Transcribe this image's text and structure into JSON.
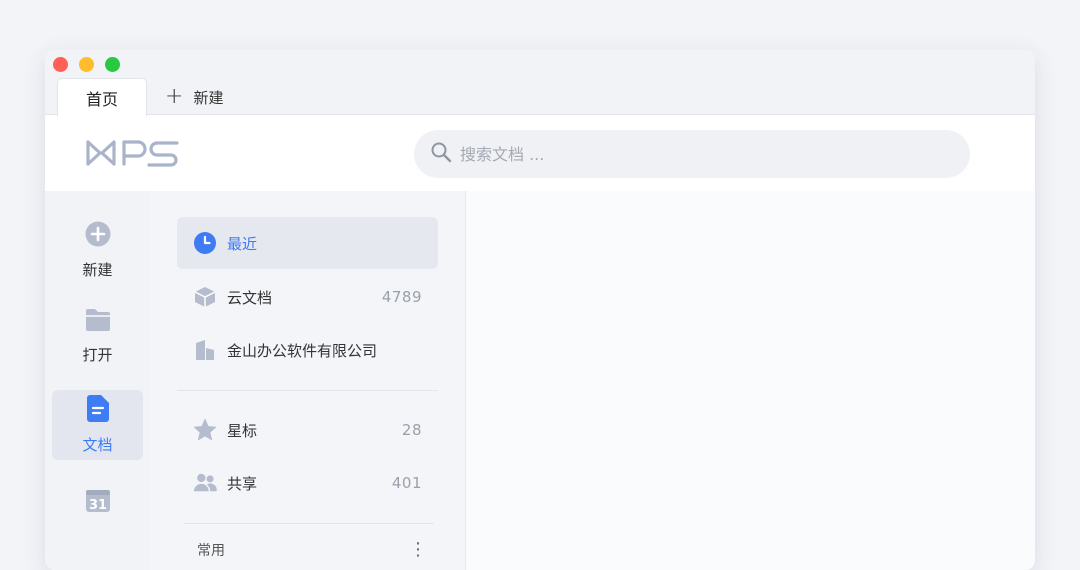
{
  "tabs": {
    "active_label": "首页",
    "new_label": "新建"
  },
  "search": {
    "placeholder": "搜索文档 ..."
  },
  "leftbar": {
    "items": [
      {
        "label": "新建",
        "icon": "plus-circle-icon"
      },
      {
        "label": "打开",
        "icon": "folder-icon"
      },
      {
        "label": "文档",
        "icon": "document-icon",
        "active": true
      },
      {
        "label": "",
        "icon": "calendar-31-icon",
        "calendar_day": "31"
      }
    ]
  },
  "panel": {
    "rows": [
      {
        "label": "最近",
        "count": "",
        "icon": "clock-icon",
        "active": true
      },
      {
        "label": "云文档",
        "count": "4789",
        "icon": "cube-icon"
      },
      {
        "label": "金山办公软件有限公司",
        "count": "",
        "icon": "building-icon"
      },
      {
        "label": "星标",
        "count": "28",
        "icon": "star-icon"
      },
      {
        "label": "共享",
        "count": "401",
        "icon": "people-icon"
      }
    ],
    "section_label": "常用",
    "section_more": "⋮"
  },
  "colors": {
    "accent": "#3d7cf5",
    "icon_gray": "#b4bccd",
    "logo": "#a9b3c9"
  }
}
